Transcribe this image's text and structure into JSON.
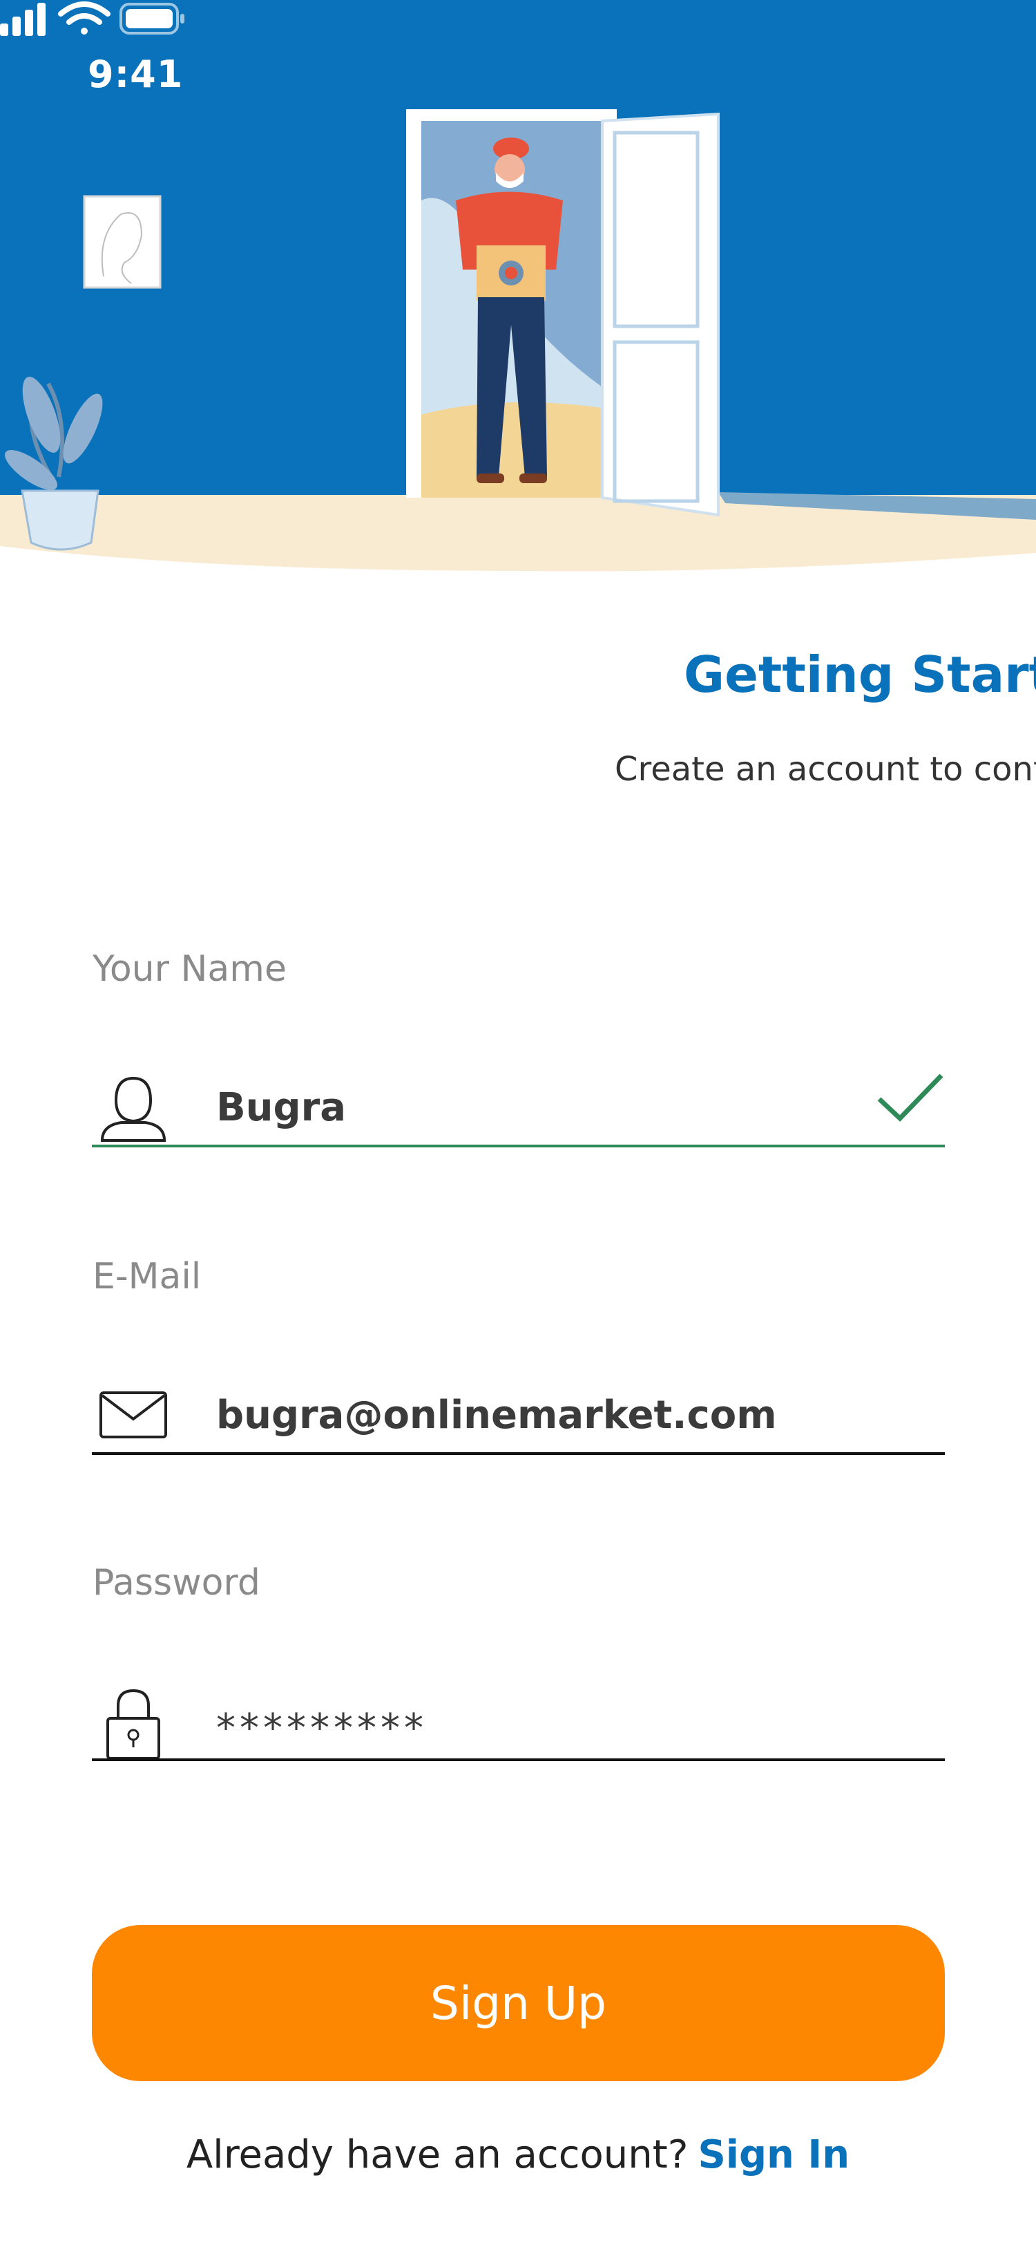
{
  "status_bar": {
    "time": "9:41",
    "icons": [
      "signal-icon",
      "wifi-icon",
      "battery-icon"
    ]
  },
  "colors": {
    "brand_blue": "#0A72BA",
    "accent_orange": "#FD8700",
    "valid_green": "#2e8b57",
    "hero_floor": "#F9EBD1"
  },
  "header": {
    "title": "Getting Started",
    "subtitle": "Create an account to continue"
  },
  "form": {
    "name": {
      "label": "Your Name",
      "value": "Bugra",
      "icon": "user-icon",
      "status": "valid"
    },
    "email": {
      "label": "E-Mail",
      "value": "bugra@onlinemarket.com",
      "icon": "mail-icon"
    },
    "password": {
      "label": "Password",
      "value": "*********",
      "icon": "lock-icon"
    }
  },
  "actions": {
    "signup_label": "Sign Up",
    "signin_prompt": "Already have an account?",
    "signin_label": "Sign In"
  }
}
